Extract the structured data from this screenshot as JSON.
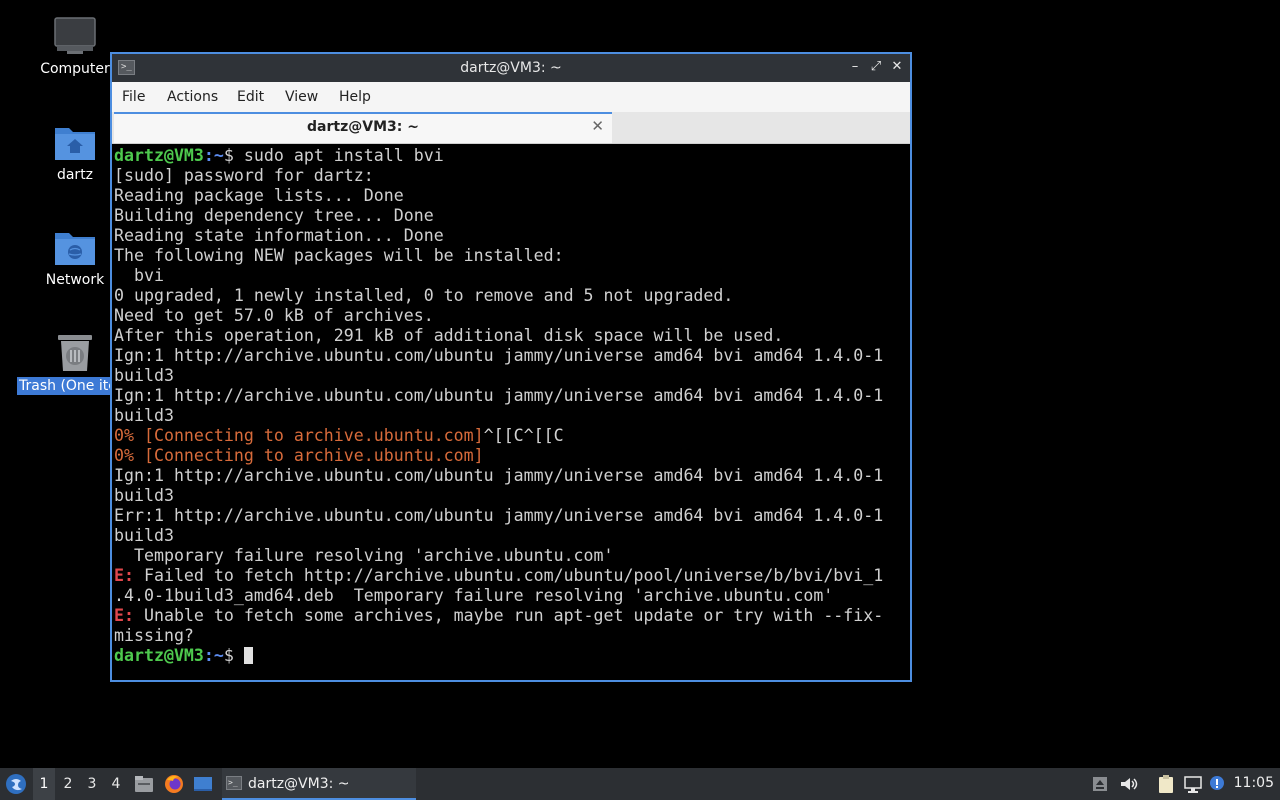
{
  "desktop": {
    "icons": [
      {
        "label": "Computer",
        "icon": "computer-icon"
      },
      {
        "label": "dartz",
        "icon": "home-folder-icon"
      },
      {
        "label": "Network",
        "icon": "network-folder-icon"
      },
      {
        "label": "Trash (One ite",
        "icon": "trash-icon",
        "selected": true
      }
    ]
  },
  "window": {
    "title": "dartz@VM3: ~",
    "controls": {
      "minimize": "–",
      "maximize": "⤢",
      "close": "✕"
    },
    "menu": [
      "File",
      "Actions",
      "Edit",
      "View",
      "Help"
    ],
    "tab": {
      "label": "dartz@VM3: ~",
      "close": "✕"
    }
  },
  "terminal": {
    "prompt_user": "dartz@VM3",
    "prompt_path": ":~",
    "prompt_symbol": "$",
    "command": " sudo apt install bvi",
    "lines": [
      {
        "type": "normal",
        "text": "[sudo] password for dartz:"
      },
      {
        "type": "normal",
        "text": "Reading package lists... Done"
      },
      {
        "type": "normal",
        "text": "Building dependency tree... Done"
      },
      {
        "type": "normal",
        "text": "Reading state information... Done"
      },
      {
        "type": "normal",
        "text": "The following NEW packages will be installed:"
      },
      {
        "type": "normal",
        "text": "  bvi"
      },
      {
        "type": "normal",
        "text": "0 upgraded, 1 newly installed, 0 to remove and 5 not upgraded."
      },
      {
        "type": "normal",
        "text": "Need to get 57.0 kB of archives."
      },
      {
        "type": "normal",
        "text": "After this operation, 291 kB of additional disk space will be used."
      },
      {
        "type": "normal",
        "text": "Ign:1 http://archive.ubuntu.com/ubuntu jammy/universe amd64 bvi amd64 1.4.0-1"
      },
      {
        "type": "normal",
        "text": "build3"
      },
      {
        "type": "normal",
        "text": "Ign:1 http://archive.ubuntu.com/ubuntu jammy/universe amd64 bvi amd64 1.4.0-1"
      },
      {
        "type": "normal",
        "text": "build3"
      },
      {
        "type": "progress",
        "text": "0% [Connecting to archive.ubuntu.com]",
        "suffix": "^[[C^[[C"
      },
      {
        "type": "progress",
        "text": "0% [Connecting to archive.ubuntu.com]",
        "suffix": ""
      },
      {
        "type": "normal",
        "text": "Ign:1 http://archive.ubuntu.com/ubuntu jammy/universe amd64 bvi amd64 1.4.0-1"
      },
      {
        "type": "normal",
        "text": "build3"
      },
      {
        "type": "normal",
        "text": "Err:1 http://archive.ubuntu.com/ubuntu jammy/universe amd64 bvi amd64 1.4.0-1"
      },
      {
        "type": "normal",
        "text": "build3"
      },
      {
        "type": "normal",
        "text": "  Temporary failure resolving 'archive.ubuntu.com'"
      },
      {
        "type": "error",
        "prefix": "E:",
        "text": " Failed to fetch http://archive.ubuntu.com/ubuntu/pool/universe/b/bvi/bvi_1"
      },
      {
        "type": "normal",
        "text": ".4.0-1build3_amd64.deb  Temporary failure resolving 'archive.ubuntu.com'"
      },
      {
        "type": "error",
        "prefix": "E:",
        "text": " Unable to fetch some archives, maybe run apt-get update or try with --fix-"
      },
      {
        "type": "normal",
        "text": "missing?"
      }
    ]
  },
  "taskbar": {
    "workspaces": [
      "1",
      "2",
      "3",
      "4"
    ],
    "active_workspace": "1",
    "quicklaunch": [
      "file-manager-icon",
      "firefox-icon",
      "desktop-icon"
    ],
    "task_label": "dartz@VM3: ~",
    "tray": [
      "update-icon",
      "volume-icon",
      "clipboard-icon",
      "network-icon",
      "notification-icon"
    ],
    "clock": "11:05"
  },
  "colors": {
    "accent": "#4d8ee0",
    "prompt_green": "#4ec94e",
    "prompt_blue": "#5c8cf0",
    "progress_orange": "#d86b3b",
    "error_red": "#e0474c"
  }
}
